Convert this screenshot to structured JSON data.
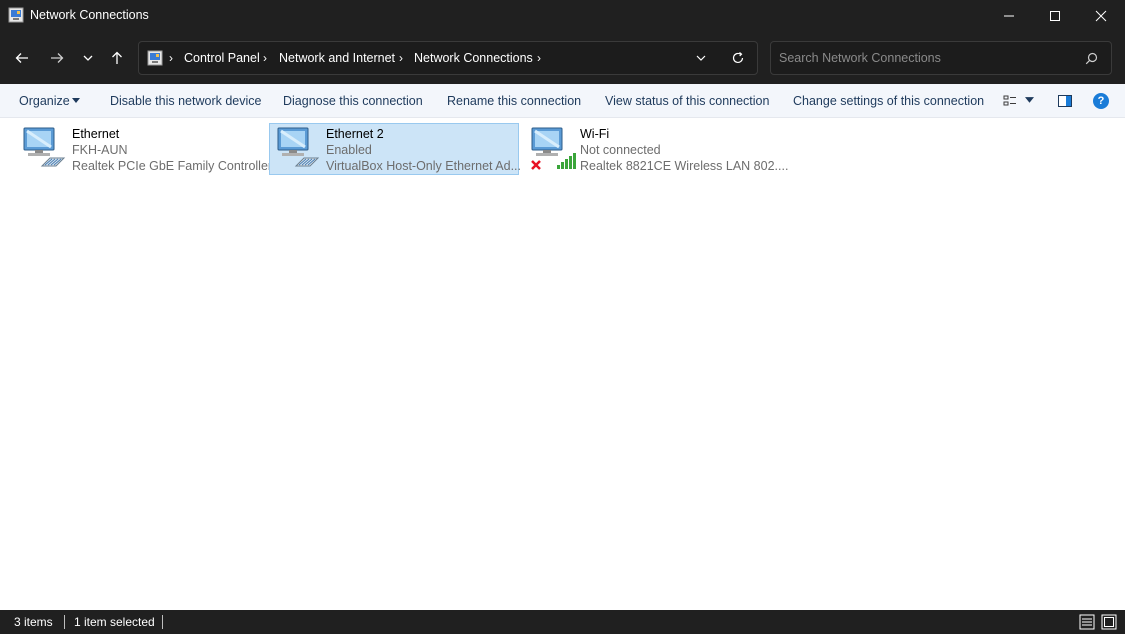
{
  "window": {
    "title": "Network Connections"
  },
  "address": {
    "crumbs": [
      "Control Panel",
      "Network and Internet",
      "Network Connections"
    ]
  },
  "search": {
    "placeholder": "Search Network Connections"
  },
  "toolbar": {
    "organize": "Organize",
    "disable": "Disable this network device",
    "diagnose": "Diagnose this connection",
    "rename": "Rename this connection",
    "view_status": "View status of this connection",
    "change_settings": "Change settings of this connection",
    "help": "?"
  },
  "connections": [
    {
      "name": "Ethernet",
      "status": "FKH-AUN",
      "device": "Realtek PCIe GbE Family Controller",
      "icon": "ethernet-icon",
      "selected": false
    },
    {
      "name": "Ethernet 2",
      "status": "Enabled",
      "device": "VirtualBox Host-Only Ethernet Ad...",
      "icon": "ethernet-icon",
      "selected": true
    },
    {
      "name": "Wi-Fi",
      "status": "Not connected",
      "device": "Realtek 8821CE Wireless LAN 802....",
      "icon": "wifi-disconnected-icon",
      "selected": false
    }
  ],
  "statusbar": {
    "items": "3 items",
    "selected": "1 item selected"
  },
  "colors": {
    "chrome": "#202020",
    "selection": "#cce4f7",
    "selection_border": "#99c9ef",
    "link": "#1e3a5c",
    "accent": "#1a7cd8",
    "error": "#e81123",
    "signal": "#3aa53a"
  }
}
